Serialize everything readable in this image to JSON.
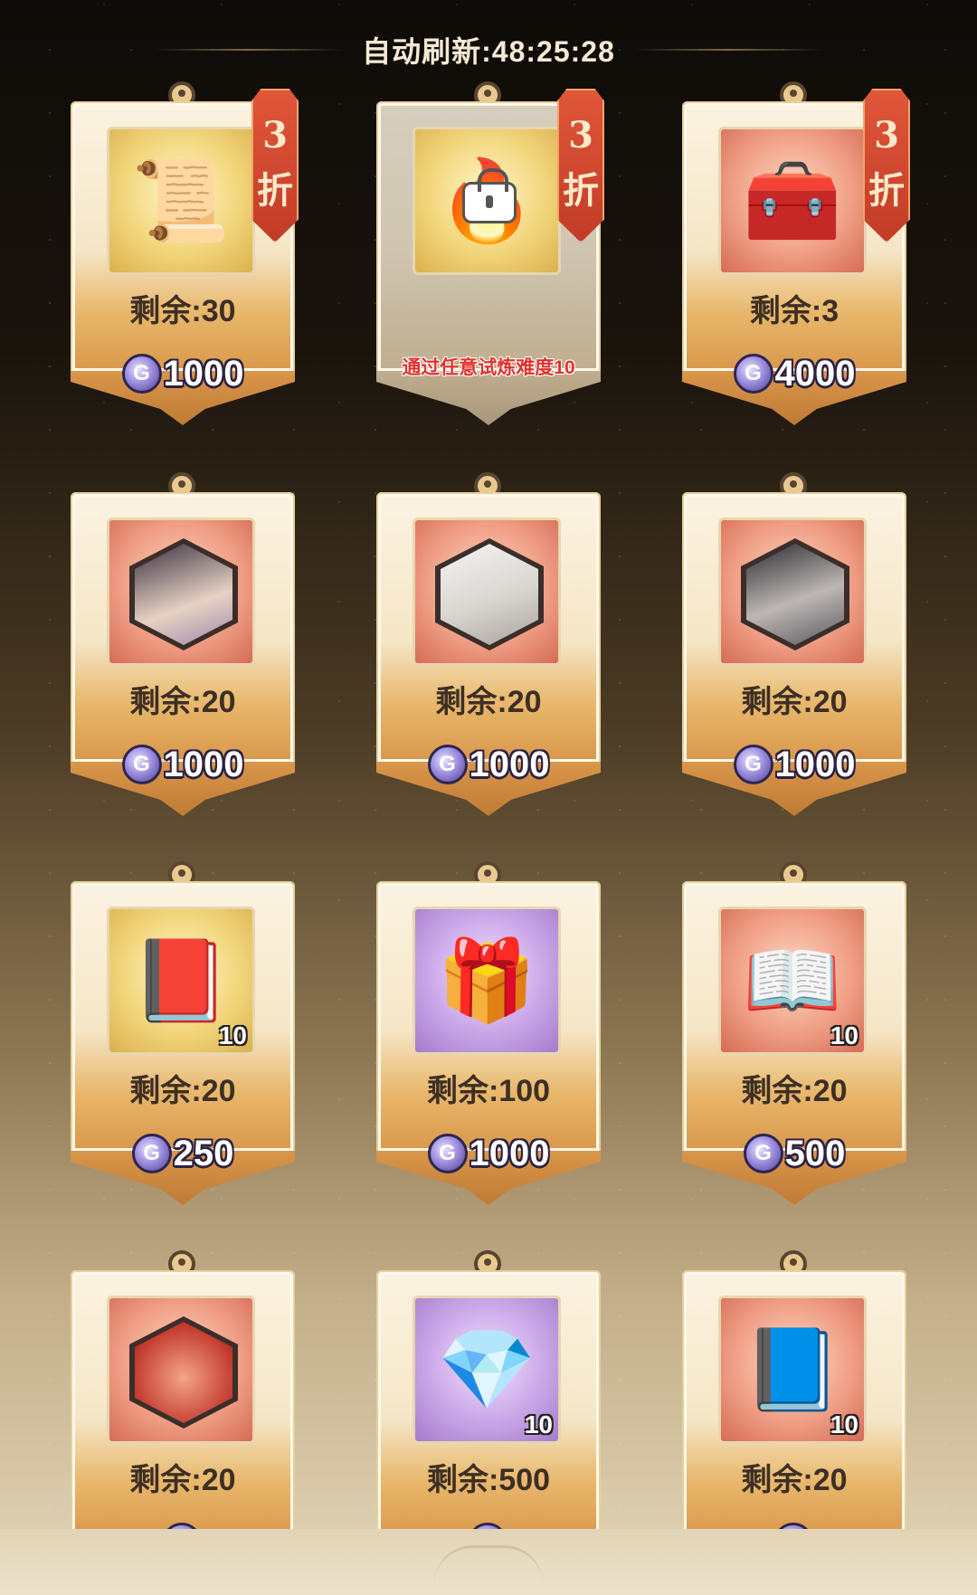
{
  "header": {
    "timer": "自动刷新:48:25:28"
  },
  "colors": {
    "price_text": "#ffffff",
    "remain_text": "#3d2f24",
    "condition_text": "#e2312b",
    "discount_badge": "#c23b26"
  },
  "items": [
    {
      "remain": "剩余:30",
      "price": "1000",
      "discount_num": "3",
      "discount_word": "折",
      "icon": "talisman-scroll-icon",
      "bg": "gold",
      "qty": ""
    },
    {
      "remain": "",
      "price": "",
      "discount_num": "3",
      "discount_word": "折",
      "icon": "locked-fire-orb-icon",
      "bg": "gold",
      "qty": "",
      "condition": "通过任意试炼难度10",
      "locked": true
    },
    {
      "remain": "剩余:3",
      "price": "4000",
      "discount_num": "3",
      "discount_word": "折",
      "icon": "treasure-chest-icon",
      "bg": "red",
      "qty": ""
    },
    {
      "remain": "剩余:20",
      "price": "1000",
      "icon": "character-portrait-dark-hair-icon",
      "bg": "red",
      "qty": ""
    },
    {
      "remain": "剩余:20",
      "price": "1000",
      "icon": "character-portrait-white-hair-icon",
      "bg": "red",
      "qty": ""
    },
    {
      "remain": "剩余:20",
      "price": "1000",
      "icon": "character-portrait-warrior-icon",
      "bg": "red",
      "qty": ""
    },
    {
      "remain": "剩余:20",
      "price": "250",
      "icon": "yin-yang-book-gold-icon",
      "bg": "gold",
      "qty": "10"
    },
    {
      "remain": "剩余:100",
      "price": "1000",
      "icon": "pearl-chest-icon",
      "bg": "purple",
      "qty": ""
    },
    {
      "remain": "剩余:20",
      "price": "500",
      "icon": "red-book-icon",
      "bg": "red",
      "qty": "10"
    },
    {
      "remain": "剩余:20",
      "price": "",
      "icon": "meditating-figure-icon",
      "bg": "red",
      "qty": ""
    },
    {
      "remain": "剩余:500",
      "price": "",
      "icon": "crystal-shard-icon",
      "bg": "purple",
      "qty": "10"
    },
    {
      "remain": "剩余:20",
      "price": "",
      "icon": "yin-yang-book-red-icon",
      "bg": "red",
      "qty": "10"
    }
  ]
}
